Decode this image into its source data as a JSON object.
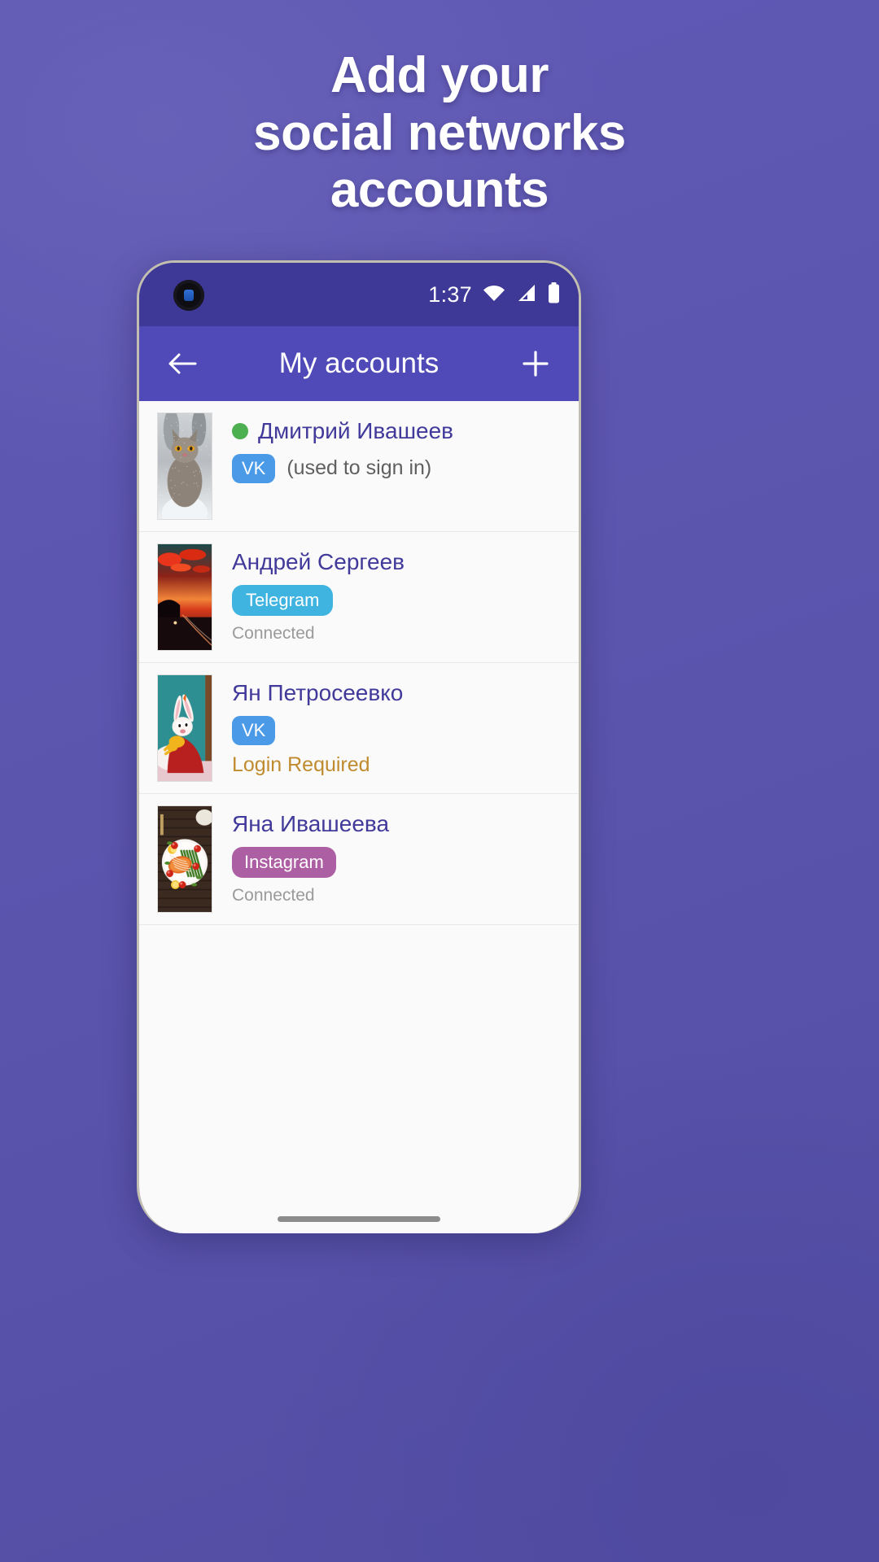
{
  "headline": {
    "lines": [
      "Add your",
      "social networks",
      "accounts"
    ]
  },
  "colors": {
    "page_background": "#5a54ac",
    "status_bar": "#3e3896",
    "app_bar": "#5049b8",
    "name_text": "#413a9a",
    "online_dot": "#4caf50",
    "vk_badge": "#4a9ae8",
    "telegram_badge": "#3fb4e0",
    "instagram_badge": "#ad5fa3",
    "login_required": "#bf8b2e",
    "connected_text": "#9a9a9a"
  },
  "status_bar": {
    "time": "1:37",
    "icons": [
      "wifi-icon",
      "cellular-signal-icon",
      "battery-icon"
    ]
  },
  "app_bar": {
    "back_icon": "back-arrow-icon",
    "title": "My accounts",
    "add_icon": "plus-icon"
  },
  "accounts": [
    {
      "avatar": "cat-in-snow-photo",
      "online": true,
      "name": "Дмитрий Ивашеев",
      "network": "VK",
      "network_key": "vk",
      "note": "(used to sign in)",
      "status": ""
    },
    {
      "avatar": "red-sunset-landscape-photo",
      "online": false,
      "name": "Андрей Сергеев",
      "network": "Telegram",
      "network_key": "telegram",
      "note": "",
      "status": "Connected"
    },
    {
      "avatar": "cartoon-rabbit-photo",
      "online": false,
      "name": "Ян Петросеевко",
      "network": "VK",
      "network_key": "vk",
      "note": "",
      "status": "Login Required",
      "status_warn": true
    },
    {
      "avatar": "salmon-asparagus-dish-photo",
      "online": false,
      "name": "Яна Ивашеева",
      "network": "Instagram",
      "network_key": "instagram",
      "note": "",
      "status": "Connected"
    }
  ],
  "gesture_bar": "home-gesture-indicator"
}
